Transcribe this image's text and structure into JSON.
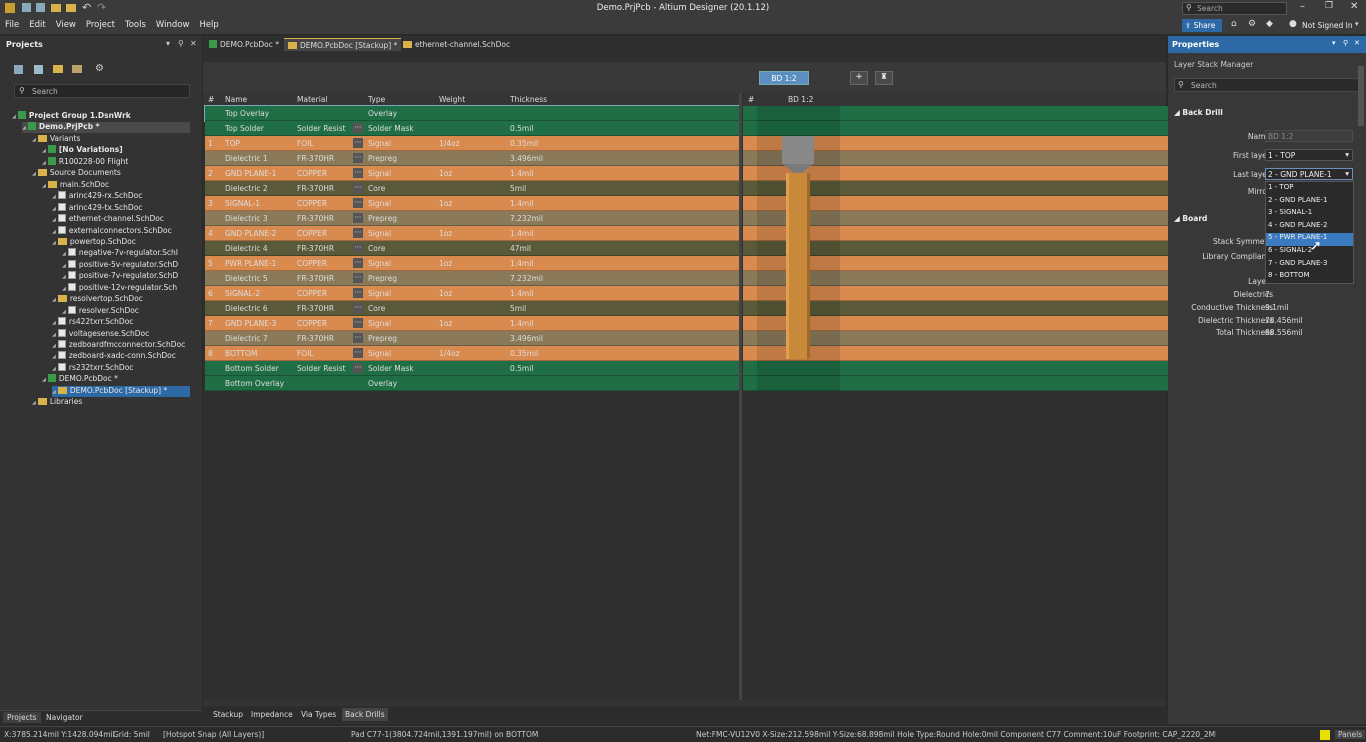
{
  "window": {
    "title": "Demo.PrjPcb - Altium Designer (20.1.12)",
    "search_placeholder": "Search"
  },
  "menu": [
    "File",
    "Edit",
    "View",
    "Project",
    "Tools",
    "Window",
    "Help"
  ],
  "topright": {
    "share": "Share",
    "signed_in": "Not Signed In"
  },
  "projects": {
    "title": "Projects",
    "search_placeholder": "Search",
    "tree": [
      {
        "label": "Project Group 1.DsnWrk",
        "depth": 0,
        "icon": "workspace-icon",
        "bold": true
      },
      {
        "label": "Demo.PrjPcb *",
        "depth": 1,
        "icon": "project-icon",
        "bold": true,
        "selected_light": true
      },
      {
        "label": "Variants",
        "depth": 2,
        "icon": "folder-icon"
      },
      {
        "label": "[No Variations]",
        "depth": 3,
        "icon": "variant-icon",
        "bold": true
      },
      {
        "label": "R100228-00 Flight",
        "depth": 3,
        "icon": "variant-icon"
      },
      {
        "label": "Source Documents",
        "depth": 2,
        "icon": "folder-icon"
      },
      {
        "label": "main.SchDoc",
        "depth": 3,
        "icon": "folder-icon"
      },
      {
        "label": "arinc429-rx.SchDoc",
        "depth": 4,
        "icon": "sheet-icon"
      },
      {
        "label": "arinc429-tx.SchDoc",
        "depth": 4,
        "icon": "sheet-icon"
      },
      {
        "label": "ethernet-channel.SchDoc",
        "depth": 4,
        "icon": "sheet-icon"
      },
      {
        "label": "externalconnectors.SchDoc",
        "depth": 4,
        "icon": "sheet-icon"
      },
      {
        "label": "powertop.SchDoc",
        "depth": 4,
        "icon": "folder-icon"
      },
      {
        "label": "negative-7v-regulator.SchI",
        "depth": 5,
        "icon": "sheet-icon"
      },
      {
        "label": "positive-5v-regulator.SchD",
        "depth": 5,
        "icon": "sheet-icon"
      },
      {
        "label": "positive-7v-regulator.SchD",
        "depth": 5,
        "icon": "sheet-icon"
      },
      {
        "label": "positive-12v-regulator.Sch",
        "depth": 5,
        "icon": "sheet-icon"
      },
      {
        "label": "resolvertop.SchDoc",
        "depth": 4,
        "icon": "folder-icon"
      },
      {
        "label": "resolver.SchDoc",
        "depth": 5,
        "icon": "sheet-icon"
      },
      {
        "label": "rs422txrr.SchDoc",
        "depth": 4,
        "icon": "sheet-icon"
      },
      {
        "label": "voltagesense.SchDoc",
        "depth": 4,
        "icon": "sheet-icon"
      },
      {
        "label": "zedboardfmcconnector.SchDoc",
        "depth": 4,
        "icon": "sheet-icon"
      },
      {
        "label": "zedboard-xadc-conn.SchDoc",
        "depth": 4,
        "icon": "sheet-icon"
      },
      {
        "label": "rs232txrr.SchDoc",
        "depth": 4,
        "icon": "sheet-icon"
      },
      {
        "label": "DEMO.PcbDoc *",
        "depth": 3,
        "icon": "pcb-icon"
      },
      {
        "label": "DEMO.PcbDoc [Stackup] *",
        "depth": 4,
        "icon": "stackup-icon",
        "selected": true
      },
      {
        "label": "Libraries",
        "depth": 2,
        "icon": "folder-icon"
      }
    ],
    "bottom_tabs": [
      "Projects",
      "Navigator"
    ]
  },
  "tabs": [
    "DEMO.PcbDoc *",
    "DEMO.PcbDoc [Stackup] *",
    "ethernet-channel.SchDoc"
  ],
  "stack": {
    "headers": [
      "#",
      "Name",
      "Material",
      "Type",
      "Weight",
      "Thickness"
    ],
    "drill_header": "#",
    "drill_name": "BD 1:2",
    "drill_button": "BD 1:2",
    "rows": [
      {
        "num": "",
        "name": "Top Overlay",
        "material": "",
        "type": "Overlay",
        "weight": "",
        "thickness": "",
        "kind": "mask"
      },
      {
        "num": "",
        "name": "Top Solder",
        "material": "Solder Resist",
        "type": "Solder Mask",
        "weight": "",
        "thickness": "0.5mil",
        "kind": "mask"
      },
      {
        "num": "1",
        "name": "TOP",
        "material": "FOIL",
        "type": "Signal",
        "weight": "1/4oz",
        "thickness": "0.35mil",
        "kind": "copper"
      },
      {
        "num": "",
        "name": "Dielectric 1",
        "material": "FR-370HR",
        "type": "Prepreg",
        "weight": "",
        "thickness": "3.496mil",
        "kind": "prepreg"
      },
      {
        "num": "2",
        "name": "GND PLANE-1",
        "material": "COPPER",
        "type": "Signal",
        "weight": "1oz",
        "thickness": "1.4mil",
        "kind": "copper"
      },
      {
        "num": "",
        "name": "Dielectric 2",
        "material": "FR-370HR",
        "type": "Core",
        "weight": "",
        "thickness": "5mil",
        "kind": "core"
      },
      {
        "num": "3",
        "name": "SIGNAL-1",
        "material": "COPPER",
        "type": "Signal",
        "weight": "1oz",
        "thickness": "1.4mil",
        "kind": "copper"
      },
      {
        "num": "",
        "name": "Dielectric 3",
        "material": "FR-370HR",
        "type": "Prepreg",
        "weight": "",
        "thickness": "7.232mil",
        "kind": "prepreg"
      },
      {
        "num": "4",
        "name": "GND PLANE-2",
        "material": "COPPER",
        "type": "Signal",
        "weight": "1oz",
        "thickness": "1.4mil",
        "kind": "copper"
      },
      {
        "num": "",
        "name": "Dielectric 4",
        "material": "FR-370HR",
        "type": "Core",
        "weight": "",
        "thickness": "47mil",
        "kind": "core"
      },
      {
        "num": "5",
        "name": "PWR PLANE-1",
        "material": "COPPER",
        "type": "Signal",
        "weight": "1oz",
        "thickness": "1.4mil",
        "kind": "copper"
      },
      {
        "num": "",
        "name": "Dielectric 5",
        "material": "FR-370HR",
        "type": "Prepreg",
        "weight": "",
        "thickness": "7.232mil",
        "kind": "prepreg"
      },
      {
        "num": "6",
        "name": "SIGNAL-2",
        "material": "COPPER",
        "type": "Signal",
        "weight": "1oz",
        "thickness": "1.4mil",
        "kind": "copper"
      },
      {
        "num": "",
        "name": "Dielectric 6",
        "material": "FR-370HR",
        "type": "Core",
        "weight": "",
        "thickness": "5mil",
        "kind": "core"
      },
      {
        "num": "7",
        "name": "GND PLANE-3",
        "material": "COPPER",
        "type": "Signal",
        "weight": "1oz",
        "thickness": "1.4mil",
        "kind": "copper"
      },
      {
        "num": "",
        "name": "Dielectric 7",
        "material": "FR-370HR",
        "type": "Prepreg",
        "weight": "",
        "thickness": "3.496mil",
        "kind": "prepreg"
      },
      {
        "num": "8",
        "name": "BOTTOM",
        "material": "FOIL",
        "type": "Signal",
        "weight": "1/4oz",
        "thickness": "0.35mil",
        "kind": "copper"
      },
      {
        "num": "",
        "name": "Bottom Solder",
        "material": "Solder Resist",
        "type": "Solder Mask",
        "weight": "",
        "thickness": "0.5mil",
        "kind": "mask"
      },
      {
        "num": "",
        "name": "Bottom Overlay",
        "material": "",
        "type": "Overlay",
        "weight": "",
        "thickness": "",
        "kind": "mask"
      }
    ],
    "bottom_tabs": [
      "Stackup",
      "Impedance",
      "Via Types",
      "Back Drills"
    ]
  },
  "properties": {
    "title": "Properties",
    "subtitle": "Layer Stack Manager",
    "search_placeholder": "Search",
    "back_drill": {
      "section": "Back Drill",
      "name_label": "Name",
      "name_value": "BD 1:2",
      "first_label": "First layer",
      "first_value": "1 - TOP",
      "last_label": "Last layer",
      "last_value": "2 - GND PLANE-1",
      "mirror_label": "Mirror"
    },
    "board": {
      "section": "Board",
      "symmetry_label": "Stack Symmetry",
      "compliance_label": "Library Compliance",
      "layers_label": "Layers",
      "dielectrics_label": "Dielectrics",
      "dielectrics_value": "7",
      "cond_label": "Conductive Thickness",
      "cond_value": "9.1mil",
      "diel_label": "Dielectric Thickness",
      "diel_value": "78.456mil",
      "total_label": "Total Thickness",
      "total_value": "88.556mil"
    },
    "dropdown_options": [
      "1 - TOP",
      "2 - GND PLANE-1",
      "3 - SIGNAL-1",
      "4 - GND PLANE-2",
      "5 - PWR PLANE-1",
      "6 - SIGNAL-2",
      "7 - GND PLANE-3",
      "8 - BOTTOM"
    ],
    "dropdown_hover_index": 4
  },
  "status": {
    "coords": "X:3785.214mil Y:1428.094mil",
    "grid": "Grid: 5mil",
    "snap": "[Hotspot Snap (All Layers)]",
    "pad": "Pad C77-1(3804.724mil,1391.197mil) on BOTTOM",
    "net": "Net:FMC-VU12V0 X-Size:212.598mil Y-Size:68.898mil Hole Type:Round Hole:0mil  Component C77 Comment:10uF Footprint: CAP_2220_2MM8",
    "panels": "Panels"
  },
  "colors": {
    "copper": "#d98a4e",
    "prepreg": "#8a7a5a",
    "core": "#5a5a3a",
    "mask": "#1f6e45",
    "accent": "#3a7bbf"
  }
}
